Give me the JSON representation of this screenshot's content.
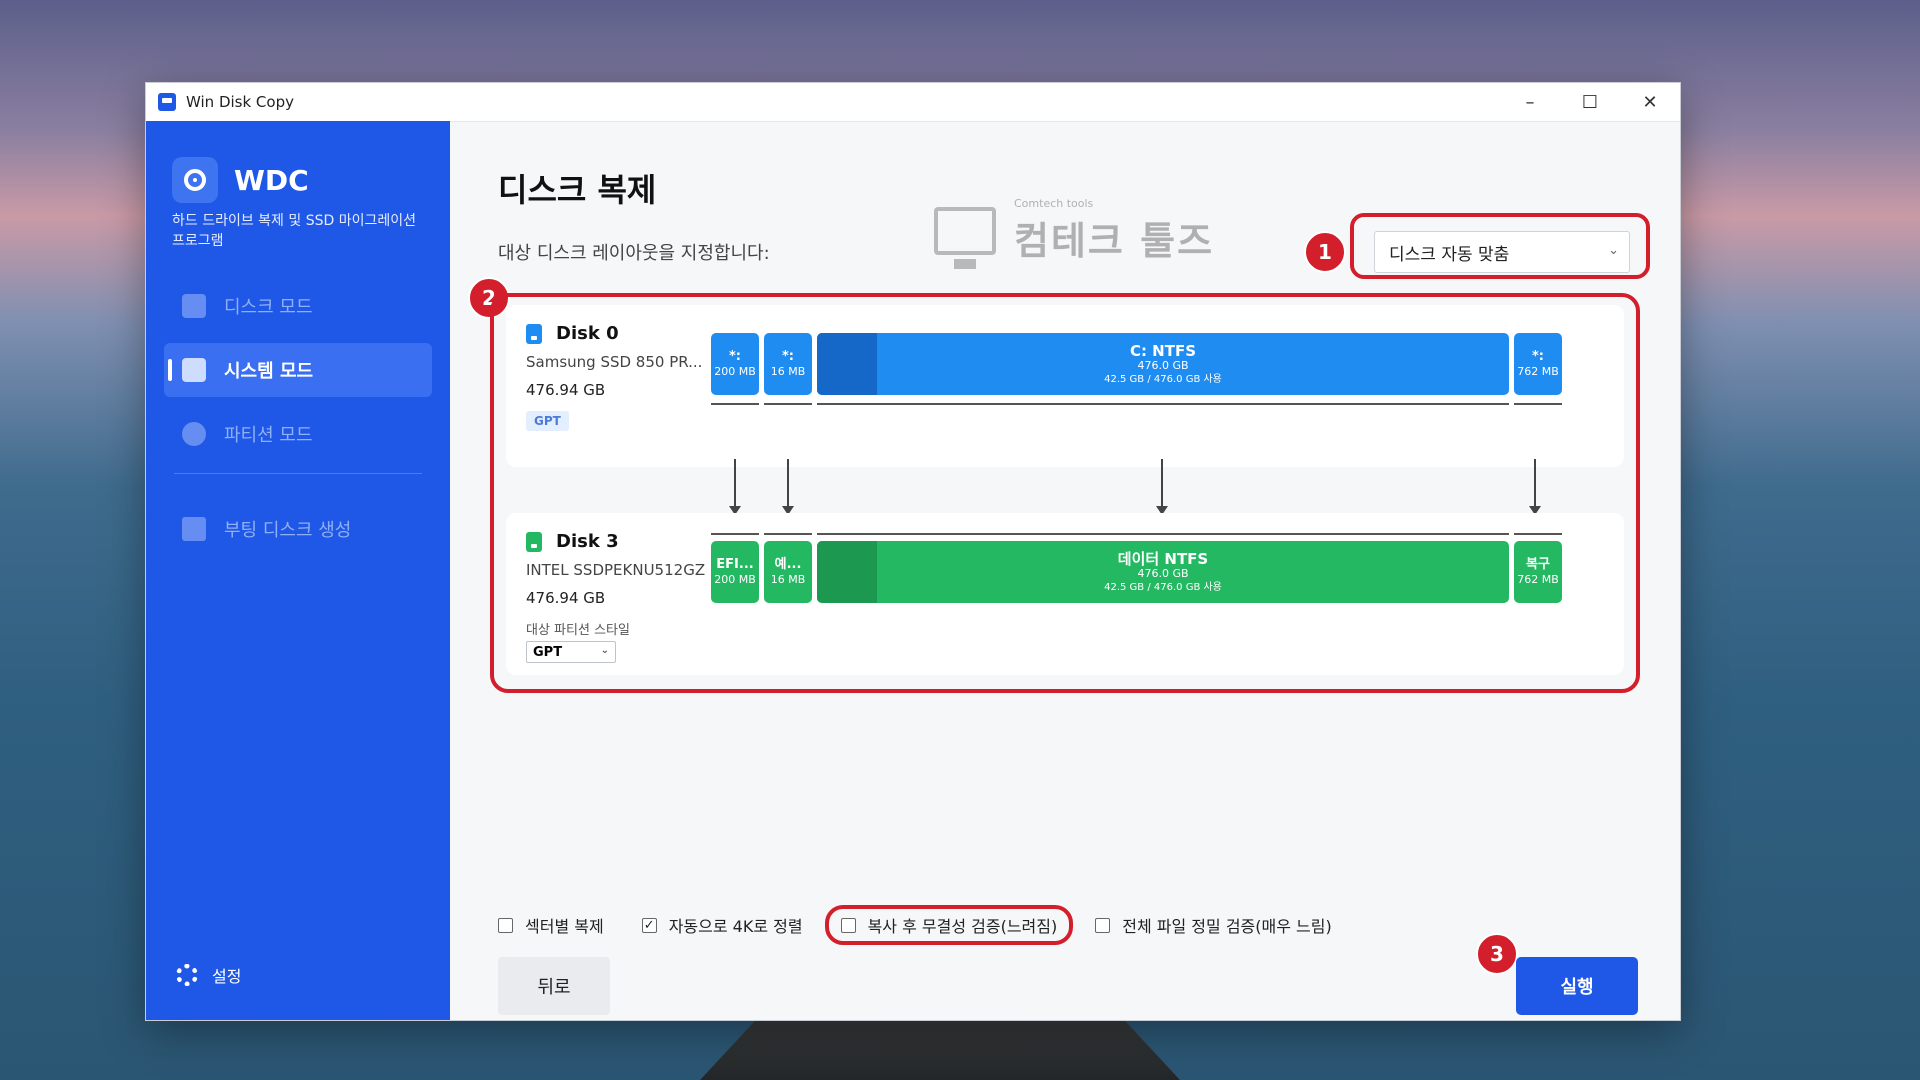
{
  "window": {
    "title": "Win Disk Copy",
    "minimize": "–",
    "maximize": "☐",
    "close": "✕"
  },
  "sidebar": {
    "brand": "WDC",
    "description": "하드 드라이브 복제 및 SSD 마이그레이션 프로그램",
    "items": [
      {
        "label": "디스크 모드",
        "icon": "disk-mode-icon",
        "active": false
      },
      {
        "label": "시스템 모드",
        "icon": "monitor-icon",
        "active": true
      },
      {
        "label": "파티션 모드",
        "icon": "pie-chart-icon",
        "active": false
      },
      {
        "label": "부팅 디스크 생성",
        "icon": "usb-drive-icon",
        "active": false
      }
    ],
    "settings_label": "설정"
  },
  "main": {
    "title": "디스크 복제",
    "subtitle": "대상 디스크 레이아웃을 지정합니다:",
    "layout_select_value": "디스크 자동 맞춤",
    "watermark_small": "Comtech tools",
    "watermark_big": "컴테크 툴즈",
    "badges": [
      "1",
      "2",
      "3"
    ]
  },
  "source_disk": {
    "name": "Disk 0",
    "model": "Samsung SSD 850 PR...",
    "size": "476.94 GB",
    "style": "GPT",
    "partitions": [
      {
        "label": "*:",
        "size": "200 MB"
      },
      {
        "label": "*:",
        "size": "16 MB"
      },
      {
        "label": "C: NTFS",
        "size": "476.0 GB",
        "usage": "42.5 GB / 476.0 GB 사용"
      },
      {
        "label": "*:",
        "size": "762 MB"
      }
    ]
  },
  "target_disk": {
    "name": "Disk 3",
    "model": "INTEL SSDPEKNU512GZ",
    "size": "476.94 GB",
    "style_label": "대상 파티션 스타일",
    "style_value": "GPT",
    "partitions": [
      {
        "label": "EFI...",
        "size": "200 MB"
      },
      {
        "label": "예...",
        "size": "16 MB"
      },
      {
        "label": "데이터 NTFS",
        "size": "476.0 GB",
        "usage": "42.5 GB / 476.0 GB 사용"
      },
      {
        "label": "복구",
        "size": "762 MB"
      }
    ]
  },
  "options": [
    {
      "label": "섹터별 복제",
      "checked": false
    },
    {
      "label": "자동으로 4K로 정렬",
      "checked": true
    },
    {
      "label": "복사 후 무결성 검증(느려짐)",
      "checked": false
    },
    {
      "label": "전체 파일 정밀 검증(매우 느림)",
      "checked": false
    }
  ],
  "buttons": {
    "back": "뒤로",
    "run": "실행"
  },
  "colors": {
    "accent": "#1f58e7",
    "source_partition": "#1f8cf2",
    "target_partition": "#25b862",
    "highlight": "#d21f2b"
  }
}
